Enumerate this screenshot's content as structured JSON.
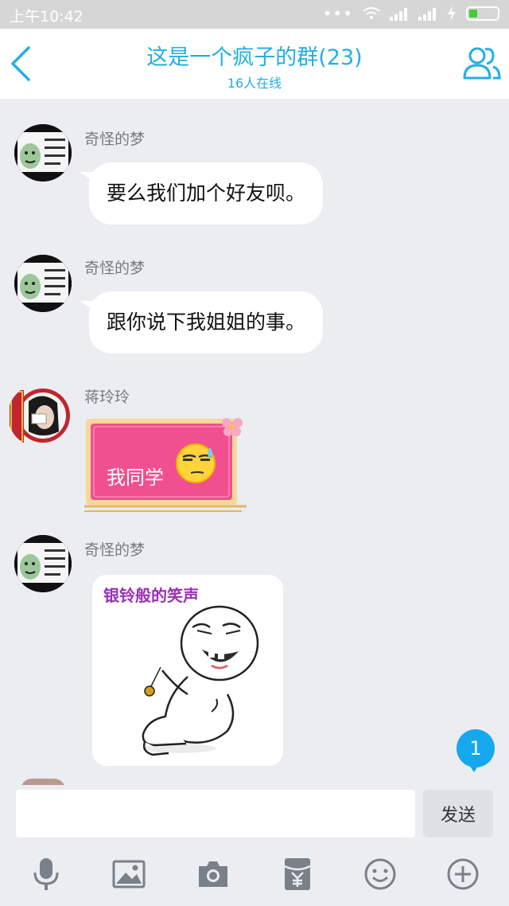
{
  "status": {
    "time": "上午10:42",
    "dots": "•••"
  },
  "header": {
    "title": "这是一个疯子的群(23)",
    "subtitle": "16人在线"
  },
  "messages": [
    {
      "sender": "奇怪的梦",
      "text": "要么我们加个好友呗。"
    },
    {
      "sender": "奇怪的梦",
      "text": "跟你说下我姐姐的事。"
    },
    {
      "sender": "蒋玲玲",
      "sticker_text": "我同学"
    },
    {
      "sender": "奇怪的梦",
      "image_caption": "银铃般的笑声"
    }
  ],
  "unread_count": "1",
  "input": {
    "value": "",
    "placeholder": ""
  },
  "send_label": "发送",
  "toolbar_icons": [
    "mic-icon",
    "image-icon",
    "camera-icon",
    "red-packet-icon",
    "emoji-icon",
    "plus-icon"
  ],
  "colors": {
    "accent": "#22aee6",
    "background": "#ebedf1",
    "sticker_pink": "#f0508f",
    "badge": "#15a8ee"
  }
}
